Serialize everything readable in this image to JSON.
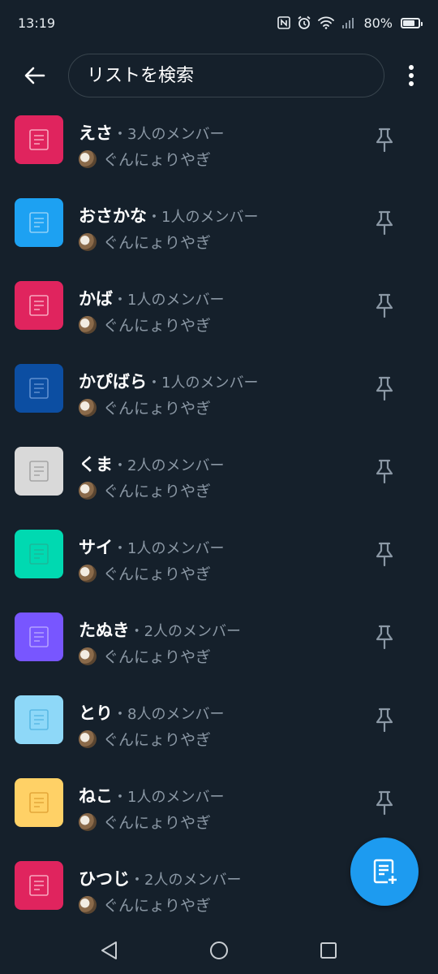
{
  "status_bar": {
    "time": "13:19",
    "battery": "80%",
    "battery_level": 0.8
  },
  "search": {
    "placeholder": "リストを検索",
    "value": ""
  },
  "owner_name": "ぐんにょりやぎ",
  "lists": [
    {
      "name": "えさ",
      "members": "・3人のメンバー",
      "color": "#e0245e",
      "fg": "#f7a6bd"
    },
    {
      "name": "おさかな",
      "members": "・1人のメンバー",
      "color": "#1da1f2",
      "fg": "#8fd0f8"
    },
    {
      "name": "かば",
      "members": "・1人のメンバー",
      "color": "#e0245e",
      "fg": "#f7a6bd"
    },
    {
      "name": "かぴばら",
      "members": "・1人のメンバー",
      "color": "#0c4ea2",
      "fg": "#5f8fd0"
    },
    {
      "name": "くま",
      "members": "・2人のメンバー",
      "color": "#d9d9d9",
      "fg": "#a5a5a5"
    },
    {
      "name": "サイ",
      "members": "・1人のメンバー",
      "color": "#00d9b1",
      "fg": "#1ab99a"
    },
    {
      "name": "たぬき",
      "members": "・2人のメンバー",
      "color": "#7856ff",
      "fg": "#b3a0ff"
    },
    {
      "name": "とり",
      "members": "・8人のメンバー",
      "color": "#8ed8f8",
      "fg": "#5ab9e5"
    },
    {
      "name": "ねこ",
      "members": "・1人のメンバー",
      "color": "#ffd166",
      "fg": "#e4a73a"
    },
    {
      "name": "ひつじ",
      "members": "・2人のメンバー",
      "color": "#e0245e",
      "fg": "#f7a6bd"
    }
  ],
  "colors": {
    "background": "#15202b",
    "accent": "#1d9bf0",
    "muted_text": "#8b98a5"
  },
  "icons": {
    "back": "arrow-left-icon",
    "more": "more-vertical-icon",
    "pin": "pin-icon",
    "list": "list-icon",
    "fab": "add-list-icon",
    "nav": [
      "nav-back-icon",
      "nav-home-icon",
      "nav-recents-icon"
    ]
  }
}
